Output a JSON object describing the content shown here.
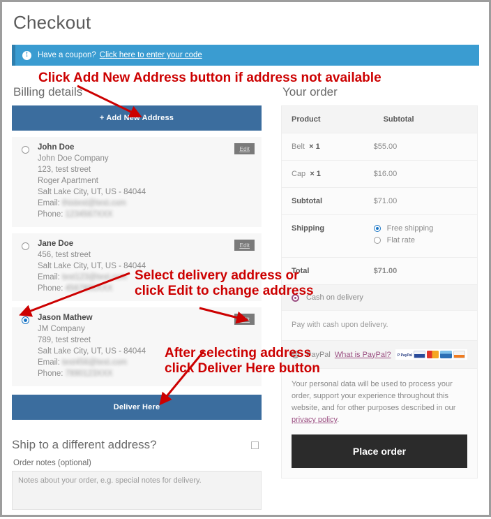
{
  "page": {
    "title": "Checkout"
  },
  "coupon": {
    "icon": "info-icon",
    "text": "Have a coupon?",
    "link": "Click here to enter your code"
  },
  "billing": {
    "heading": "Billing details",
    "add_new_address_label": "+ Add New Address",
    "deliver_here_label": "Deliver Here",
    "edit_label": "Edit",
    "addresses": [
      {
        "selected": false,
        "name": "John Doe",
        "company": "John Doe Company",
        "street": "123, test street",
        "apartment": "Roger Apartment",
        "city_state_zip": "Salt Lake City, UT, US - 84044",
        "email_label": "Email:",
        "email_value": "thistest@test.com",
        "phone_label": "Phone:",
        "phone_value": "1234567XXX"
      },
      {
        "selected": false,
        "name": "Jane Doe",
        "company": "",
        "street": "456, test street",
        "apartment": "",
        "city_state_zip": "Salt Lake City, UT, US - 84044",
        "email_label": "Email:",
        "email_value": "test123@test.com",
        "phone_label": "Phone:",
        "phone_value": "4567890XXX"
      },
      {
        "selected": true,
        "name": "Jason Mathew",
        "company": "JM Company",
        "street": "789, test street",
        "apartment": "",
        "city_state_zip": "Salt Lake City, UT, US - 84044",
        "email_label": "Email:",
        "email_value": "test456@test.com",
        "phone_label": "Phone:",
        "phone_value": "7890123XXX"
      }
    ]
  },
  "shipping_alt": {
    "title": "Ship to a different address?",
    "checked": false,
    "notes_label": "Order notes (optional)",
    "notes_placeholder": "Notes about your order, e.g. special notes for delivery.",
    "notes_value": ""
  },
  "order": {
    "heading": "Your order",
    "columns": [
      "Product",
      "Subtotal"
    ],
    "items": [
      {
        "name": "Belt",
        "qty": "× 1",
        "subtotal": "$55.00"
      },
      {
        "name": "Cap",
        "qty": "× 1",
        "subtotal": "$16.00"
      }
    ],
    "subtotal_label": "Subtotal",
    "subtotal_value": "$71.00",
    "shipping_label": "Shipping",
    "shipping_options": [
      {
        "label": "Free shipping",
        "selected": true
      },
      {
        "label": "Flat rate",
        "selected": false
      }
    ],
    "total_label": "Total",
    "total_value": "$71.00"
  },
  "payment": {
    "methods": [
      {
        "label": "Cash on delivery",
        "selected": true
      },
      {
        "label": "PayPal",
        "selected": false
      }
    ],
    "cod_description": "Pay with cash upon delivery.",
    "paypal_link": "What is PayPal?",
    "card_icons": [
      "paypal-logo",
      "visa-card-icon",
      "mastercard-card-icon",
      "amex-card-icon",
      "discover-card-icon"
    ],
    "paypal_logo_text": "P PayPal"
  },
  "privacy": {
    "text_before_link": "Your personal data will be used to process your order, support your experience throughout this website, and for other purposes described in our ",
    "link": "privacy policy",
    "text_after_link": ".",
    "place_order_label": "Place order"
  },
  "annotations": [
    {
      "id": "anno-1",
      "text": "Click Add New Address button if address not available"
    },
    {
      "id": "anno-2",
      "text": "Select delivery address or\nclick Edit to change address"
    },
    {
      "id": "anno-3",
      "text": "After selecting address\nclick Deliver Here button"
    }
  ],
  "colors": {
    "accent_blue": "#3b6d9e",
    "coupon_blue": "#3a9cd1",
    "annotation_red": "#cc0000",
    "payment_purple": "#9b4f82",
    "place_order_dark": "#2b2b2b"
  }
}
